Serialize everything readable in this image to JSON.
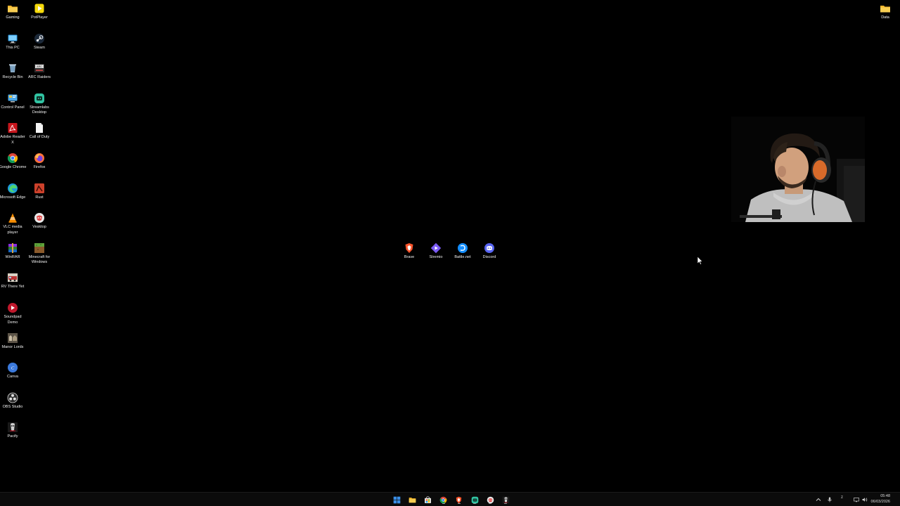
{
  "desktop": {
    "icons_left": [
      {
        "label": "Gaming",
        "icon": "folder-icon",
        "name": "desktop-icon-gaming"
      },
      {
        "label": "PotPlayer",
        "icon": "potplayer-icon",
        "name": "desktop-icon-potplayer"
      },
      {
        "label": "This PC",
        "icon": "this-pc-icon",
        "name": "desktop-icon-this-pc"
      },
      {
        "label": "Steam",
        "icon": "steam-icon",
        "name": "desktop-icon-steam"
      },
      {
        "label": "Recycle Bin",
        "icon": "recycle-bin-icon",
        "name": "desktop-icon-recycle-bin"
      },
      {
        "label": "ARC Raiders",
        "icon": "arc-raiders-icon",
        "name": "desktop-icon-arc-raiders"
      },
      {
        "label": "Control Panel",
        "icon": "control-panel-icon",
        "name": "desktop-icon-control-panel"
      },
      {
        "label": "Streamlabs Desktop",
        "icon": "streamlabs-icon",
        "name": "desktop-icon-streamlabs"
      },
      {
        "label": "Adobe Reader X",
        "icon": "adobe-reader-icon",
        "name": "desktop-icon-adobe-reader"
      },
      {
        "label": "Call of Duty",
        "icon": "document-icon",
        "name": "desktop-icon-call-of-duty"
      },
      {
        "label": "Google Chrome",
        "icon": "chrome-icon",
        "name": "desktop-icon-chrome"
      },
      {
        "label": "Firefox",
        "icon": "firefox-icon",
        "name": "desktop-icon-firefox"
      },
      {
        "label": "Microsoft Edge",
        "icon": "edge-icon",
        "name": "desktop-icon-edge"
      },
      {
        "label": "Rust",
        "icon": "rust-icon",
        "name": "desktop-icon-rust"
      },
      {
        "label": "VLC media player",
        "icon": "vlc-icon",
        "name": "desktop-icon-vlc"
      },
      {
        "label": "Vesktop",
        "icon": "vesktop-icon",
        "name": "desktop-icon-vesktop"
      },
      {
        "label": "WinRAR",
        "icon": "winrar-icon",
        "name": "desktop-icon-winrar"
      },
      {
        "label": "Minecraft for Windows",
        "icon": "minecraft-icon",
        "name": "desktop-icon-minecraft"
      },
      {
        "label": "RV There Yet",
        "icon": "rv-there-yet-icon",
        "name": "desktop-icon-rv-there-yet"
      },
      {
        "label": "Soundpad Demo",
        "icon": "soundpad-icon",
        "name": "desktop-icon-soundpad"
      },
      {
        "label": "Manor Lords",
        "icon": "manor-lords-icon",
        "name": "desktop-icon-manor-lords"
      },
      {
        "label": "Canva",
        "icon": "canva-icon",
        "name": "desktop-icon-canva"
      },
      {
        "label": "OBS Studio",
        "icon": "obs-icon",
        "name": "desktop-icon-obs"
      },
      {
        "label": "Pacify",
        "icon": "pacify-icon",
        "name": "desktop-icon-pacify"
      }
    ],
    "icons_center": [
      {
        "label": "Brave",
        "icon": "brave-icon",
        "name": "desktop-icon-brave"
      },
      {
        "label": "Stremio",
        "icon": "stremio-icon",
        "name": "desktop-icon-stremio"
      },
      {
        "label": "Battle.net",
        "icon": "battlenet-icon",
        "name": "desktop-icon-battlenet"
      },
      {
        "label": "Discord",
        "icon": "discord-icon",
        "name": "desktop-icon-discord"
      }
    ],
    "icons_right": [
      {
        "label": "Data",
        "icon": "folder-icon",
        "name": "desktop-icon-data"
      }
    ]
  },
  "taskbar": {
    "apps": [
      {
        "name": "start-button",
        "icon": "windows-start-icon"
      },
      {
        "name": "taskbar-file-explorer",
        "icon": "file-explorer-icon"
      },
      {
        "name": "taskbar-store",
        "icon": "store-icon"
      },
      {
        "name": "taskbar-chrome",
        "icon": "chrome-icon"
      },
      {
        "name": "taskbar-brave",
        "icon": "brave-icon"
      },
      {
        "name": "taskbar-streamlabs",
        "icon": "streamlabs-icon"
      },
      {
        "name": "taskbar-vesktop",
        "icon": "vesktop-icon"
      },
      {
        "name": "taskbar-pacify",
        "icon": "pacify-icon"
      }
    ],
    "tray": {
      "ime": "z",
      "time": "05:48",
      "date": "06/03/2026"
    }
  },
  "colors": {
    "background": "#000000",
    "taskbar": "#0b0b0b",
    "folder": "#f5c542",
    "start_blue": "#3a8ee6"
  }
}
